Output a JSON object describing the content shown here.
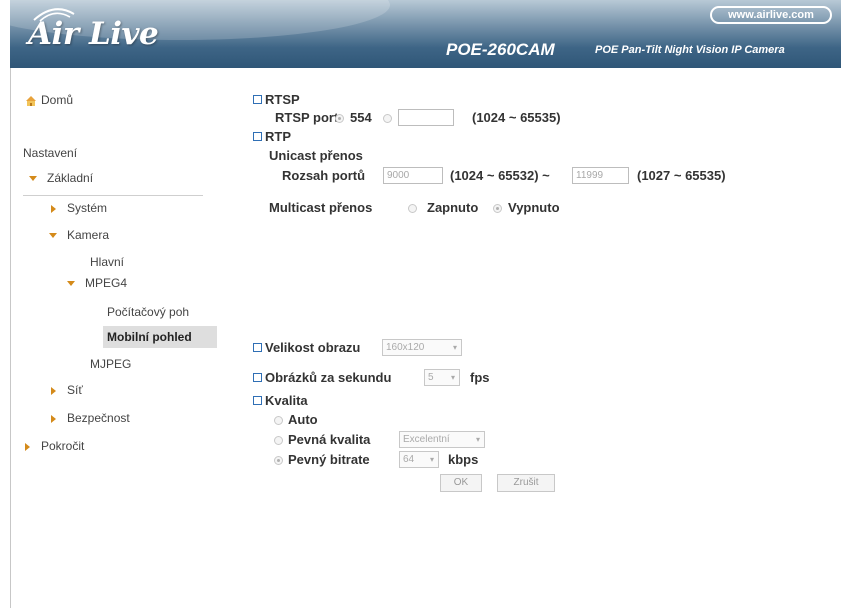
{
  "header": {
    "logo": "Air Live",
    "url": "www.airlive.com",
    "model": "POE-260CAM",
    "subtitle": "POE Pan-Tilt Night Vision IP Camera"
  },
  "sidebar": {
    "home": "Domů",
    "section": "Nastavení",
    "items": {
      "zakladni": "Základní",
      "system": "Systém",
      "kamera": "Kamera",
      "hlavni": "Hlavní",
      "mpeg4": "MPEG4",
      "pocitacovy": "Počítačový poh",
      "mobilni": "Mobilní pohled",
      "mjpeg": "MJPEG",
      "sit": "Síť",
      "bezpecnost": "Bezpečnost",
      "pokrocit": "Pokročit"
    }
  },
  "rtsp": {
    "title": "RTSP",
    "port_label": "RTSP port",
    "port_default": "554",
    "port_custom_value": "",
    "range": "(1024 ~ 65535)"
  },
  "rtp": {
    "title": "RTP",
    "unicast_label": "Unicast přenos",
    "port_range_label": "Rozsah portů",
    "port_from": "9000",
    "range_from": "(1024 ~ 65532) ~",
    "port_to": "11999",
    "range_to": "(1027 ~ 65535)",
    "multicast_label": "Multicast přenos",
    "multicast_on": "Zapnuto",
    "multicast_off": "Vypnuto"
  },
  "image_size": {
    "label": "Velikost obrazu",
    "value": "160x120"
  },
  "fps": {
    "label": "Obrázků za sekundu",
    "value": "5",
    "unit": "fps"
  },
  "quality": {
    "title": "Kvalita",
    "auto": "Auto",
    "fixed_quality": "Pevná kvalita",
    "fixed_quality_value": "Excelentní",
    "fixed_bitrate": "Pevný bitrate",
    "bitrate_value": "64",
    "bitrate_unit": "kbps"
  },
  "buttons": {
    "ok": "OK",
    "cancel": "Zrušit"
  }
}
